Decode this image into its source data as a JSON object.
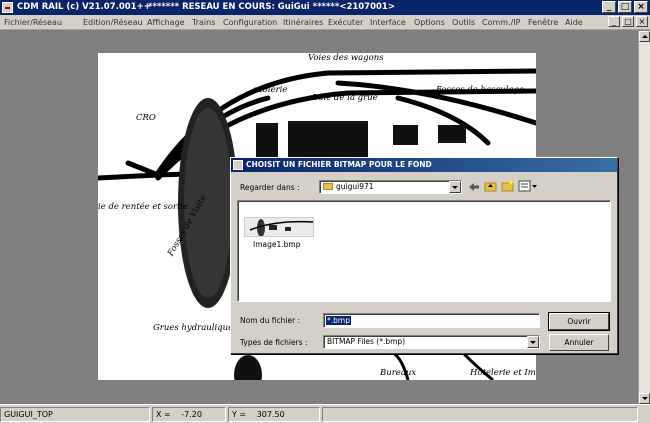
{
  "window": {
    "title": "CDM RAIL (c) V21.07.001++",
    "status": "******* RESEAU EN COURS: GuiGui ******<2107001>",
    "controls": [
      "_",
      "□",
      "×"
    ]
  },
  "menu": {
    "items": [
      "Fichier/Réseau",
      "Edition/Réseau",
      "Affichage",
      "Trains",
      "Configuration",
      "Itinéraires",
      "Exécuter",
      "Interface",
      "Options",
      "Outils",
      "Comm./IP",
      "Fenêtre",
      "Aide"
    ],
    "mdi_controls": [
      "_",
      "□",
      "×"
    ]
  },
  "background_map": {
    "labels": [
      "Voies des wagons",
      "sablerie",
      "Voie de la grue",
      "Fosses de basculage",
      "CRO",
      "ie de rentée et sortie",
      "Fosses de Visite",
      "Grues hydraulique",
      "Bureaux",
      "Hôtelerie et Immobilier"
    ]
  },
  "dialog": {
    "title": "CHOISIT UN FICHIER BITMAP POUR LE FOND",
    "lookin_label": "Regarder dans :",
    "lookin_value": "guigui971",
    "files": [
      {
        "name": "Image1.bmp",
        "icon": "bitmap-thumbnail"
      }
    ],
    "filename_label": "Nom du fichier :",
    "filename_value": "*.bmp",
    "filetype_label": "Types de fichiers :",
    "filetype_value": "BITMAP Files (*.bmp)",
    "open_button": "Ouvrir",
    "cancel_button": "Annuler",
    "toolbar_icons": [
      "back-arrow-icon",
      "up-folder-icon",
      "new-folder-icon",
      "view-menu-icon"
    ]
  },
  "statusbar": {
    "layer": "GUIGUI_TOP",
    "x_label": "X =",
    "x_value": "-7.20",
    "y_label": "Y =",
    "y_value": "307.50"
  }
}
